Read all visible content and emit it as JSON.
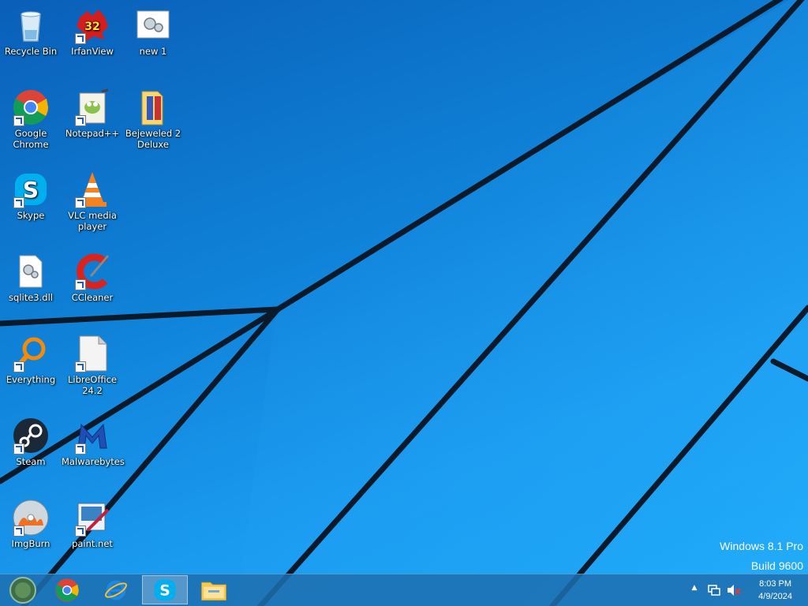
{
  "desktop": {
    "icons": [
      {
        "label": "Recycle Bin",
        "icon": "recycle-bin-icon"
      },
      {
        "label": "IrfanView",
        "icon": "irfanview-icon",
        "badge": "32"
      },
      {
        "label": "new 1",
        "icon": "new-1-file-icon"
      },
      {
        "label": "Google Chrome",
        "icon": "chrome-icon"
      },
      {
        "label": "Notepad++",
        "icon": "notepadpp-icon"
      },
      {
        "label": "Bejeweled 2 Deluxe",
        "icon": "folder-icon"
      },
      {
        "label": "Skype",
        "icon": "skype-icon"
      },
      {
        "label": "VLC media player",
        "icon": "vlc-icon"
      },
      {
        "label": "sqlite3.dll",
        "icon": "dll-file-icon"
      },
      {
        "label": "CCleaner",
        "icon": "ccleaner-icon"
      },
      {
        "label": "Everything",
        "icon": "everything-icon"
      },
      {
        "label": "LibreOffice 24.2",
        "icon": "libreoffice-icon"
      },
      {
        "label": "Steam",
        "icon": "steam-icon"
      },
      {
        "label": "Malwarebytes",
        "icon": "malwarebytes-icon"
      },
      {
        "label": "ImgBurn",
        "icon": "imgburn-icon"
      },
      {
        "label": "paint.net",
        "icon": "paintnet-icon"
      }
    ]
  },
  "watermark": {
    "line1": "Windows 8.1 Pro",
    "line2": "Build 9600"
  },
  "taskbar": {
    "pinned": [
      {
        "name": "start",
        "icon": "start-orb-icon"
      },
      {
        "name": "chrome",
        "icon": "chrome-icon"
      },
      {
        "name": "internet-explorer",
        "icon": "internet-explorer-icon"
      },
      {
        "name": "skype",
        "icon": "skype-icon",
        "active": true
      },
      {
        "name": "file-explorer",
        "icon": "file-explorer-icon"
      }
    ],
    "tray": {
      "time": "8:03 PM",
      "date": "4/9/2024"
    }
  },
  "colors": {
    "wallpaper": "#0f82d8",
    "taskbar": "#1e6eaf"
  }
}
